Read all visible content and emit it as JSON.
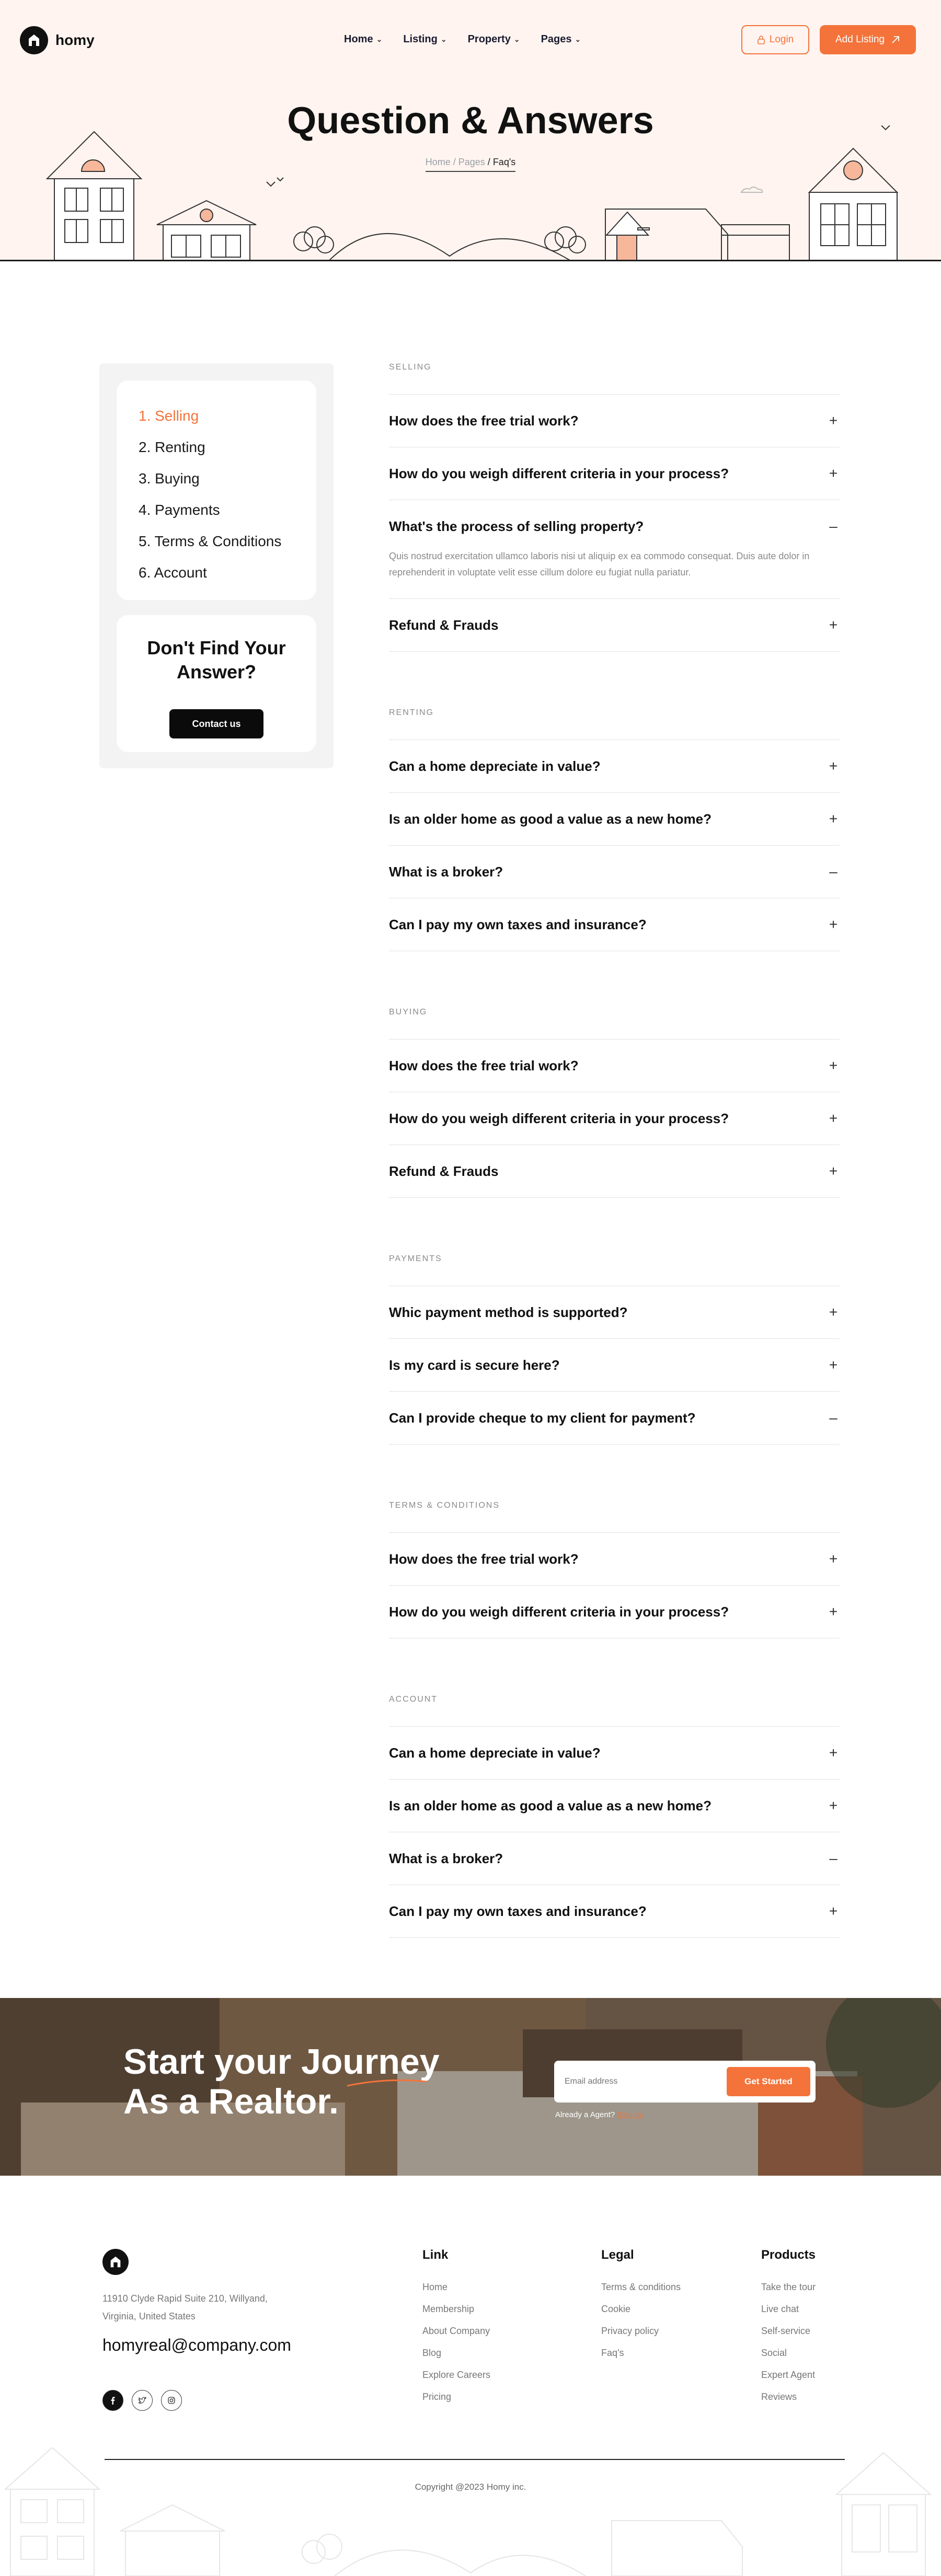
{
  "nav": {
    "brand": "homy",
    "menu": [
      {
        "label": "Home"
      },
      {
        "label": "Listing"
      },
      {
        "label": "Property"
      },
      {
        "label": "Pages"
      }
    ],
    "login_label": "Login",
    "add_listing_label": "Add Listing"
  },
  "hero": {
    "title": "Question & Answers",
    "breadcrumb": {
      "home": "Home",
      "sep1": " / ",
      "pages": "Pages",
      "sep2": " / ",
      "current": "Faq's"
    }
  },
  "sidebar": {
    "items": [
      {
        "label": "1. Selling"
      },
      {
        "label": "2. Renting"
      },
      {
        "label": "3. Buying"
      },
      {
        "label": "4. Payments"
      },
      {
        "label": "5. Terms & Conditions"
      },
      {
        "label": "6. Account"
      }
    ],
    "cta_title": "Don't Find Your Answer?",
    "cta_button": "Contact us"
  },
  "faq": {
    "sections": [
      {
        "label": "SELLING",
        "items": [
          {
            "q": "How does the free trial work?",
            "icon": "+"
          },
          {
            "q": "How do you weigh different criteria in your process?",
            "icon": "+"
          },
          {
            "q": "What's the process of selling property?",
            "icon": "–",
            "a": "Quis nostrud exercitation ullamco laboris nisi ut aliquip ex ea commodo consequat. Duis aute dolor in reprehenderit in voluptate velit esse cillum dolore eu fugiat nulla pariatur."
          },
          {
            "q": "Refund & Frauds",
            "icon": "+"
          }
        ]
      },
      {
        "label": "RENTING",
        "items": [
          {
            "q": "Can a home depreciate in value?",
            "icon": "+"
          },
          {
            "q": "Is an older home as good a value as a new home?",
            "icon": "+"
          },
          {
            "q": "What is a broker?",
            "icon": "–"
          },
          {
            "q": "Can I pay my own taxes and insurance?",
            "icon": "+"
          }
        ]
      },
      {
        "label": "BUYING",
        "items": [
          {
            "q": "How does the free trial work?",
            "icon": "+"
          },
          {
            "q": "How do you weigh different criteria in your process?",
            "icon": "+"
          },
          {
            "q": "Refund & Frauds",
            "icon": "+"
          }
        ]
      },
      {
        "label": "PAYMENTS",
        "items": [
          {
            "q": "Whic payment method is supported?",
            "icon": "+"
          },
          {
            "q": "Is my card is secure here?",
            "icon": "+"
          },
          {
            "q": "Can I provide cheque to my client for payment?",
            "icon": "–"
          }
        ]
      },
      {
        "label": "TERMS & CONDITIONS",
        "items": [
          {
            "q": "How does the free trial work?",
            "icon": "+"
          },
          {
            "q": "How do you weigh different criteria in your process?",
            "icon": "+"
          }
        ]
      },
      {
        "label": "ACCOUNT",
        "items": [
          {
            "q": "Can a home depreciate in value?",
            "icon": "+"
          },
          {
            "q": "Is an older home as good a value as a new home?",
            "icon": "+"
          },
          {
            "q": "What is a broker?",
            "icon": "–"
          },
          {
            "q": "Can I pay my own taxes and insurance?",
            "icon": "+"
          }
        ]
      }
    ]
  },
  "banner": {
    "title_line1": "Start your Journey",
    "title_line2": "As a Realtor.",
    "email_placeholder": "Email address",
    "button": "Get Started",
    "already_text": "Already a Agent?",
    "signin_text": "Sign in."
  },
  "footer": {
    "address": "11910 Clyde Rapid Suite 210, Willyand, Virginia, United States",
    "email": "homyreal@company.com",
    "columns": [
      {
        "title": "Link",
        "links": [
          "Home",
          "Membership",
          "About Company",
          "Blog",
          "Explore Careers",
          "Pricing"
        ]
      },
      {
        "title": "Legal",
        "links": [
          "Terms & conditions",
          "Cookie",
          "Privacy policy",
          "Faq's"
        ]
      },
      {
        "title": "Products",
        "links": [
          "Take the tour",
          "Live chat",
          "Self-service",
          "Social",
          "Expert Agent",
          "Reviews"
        ]
      }
    ],
    "copyright": "Copyright @2023 Homy inc."
  },
  "colors": {
    "accent": "#f4733a",
    "hero_bg": "#fff4f0",
    "dark": "#111111"
  },
  "icons": [
    "home-logo-icon",
    "lock-icon",
    "arrow-up-right-icon",
    "plus-icon",
    "minus-icon",
    "facebook-icon",
    "twitter-icon",
    "instagram-icon"
  ]
}
